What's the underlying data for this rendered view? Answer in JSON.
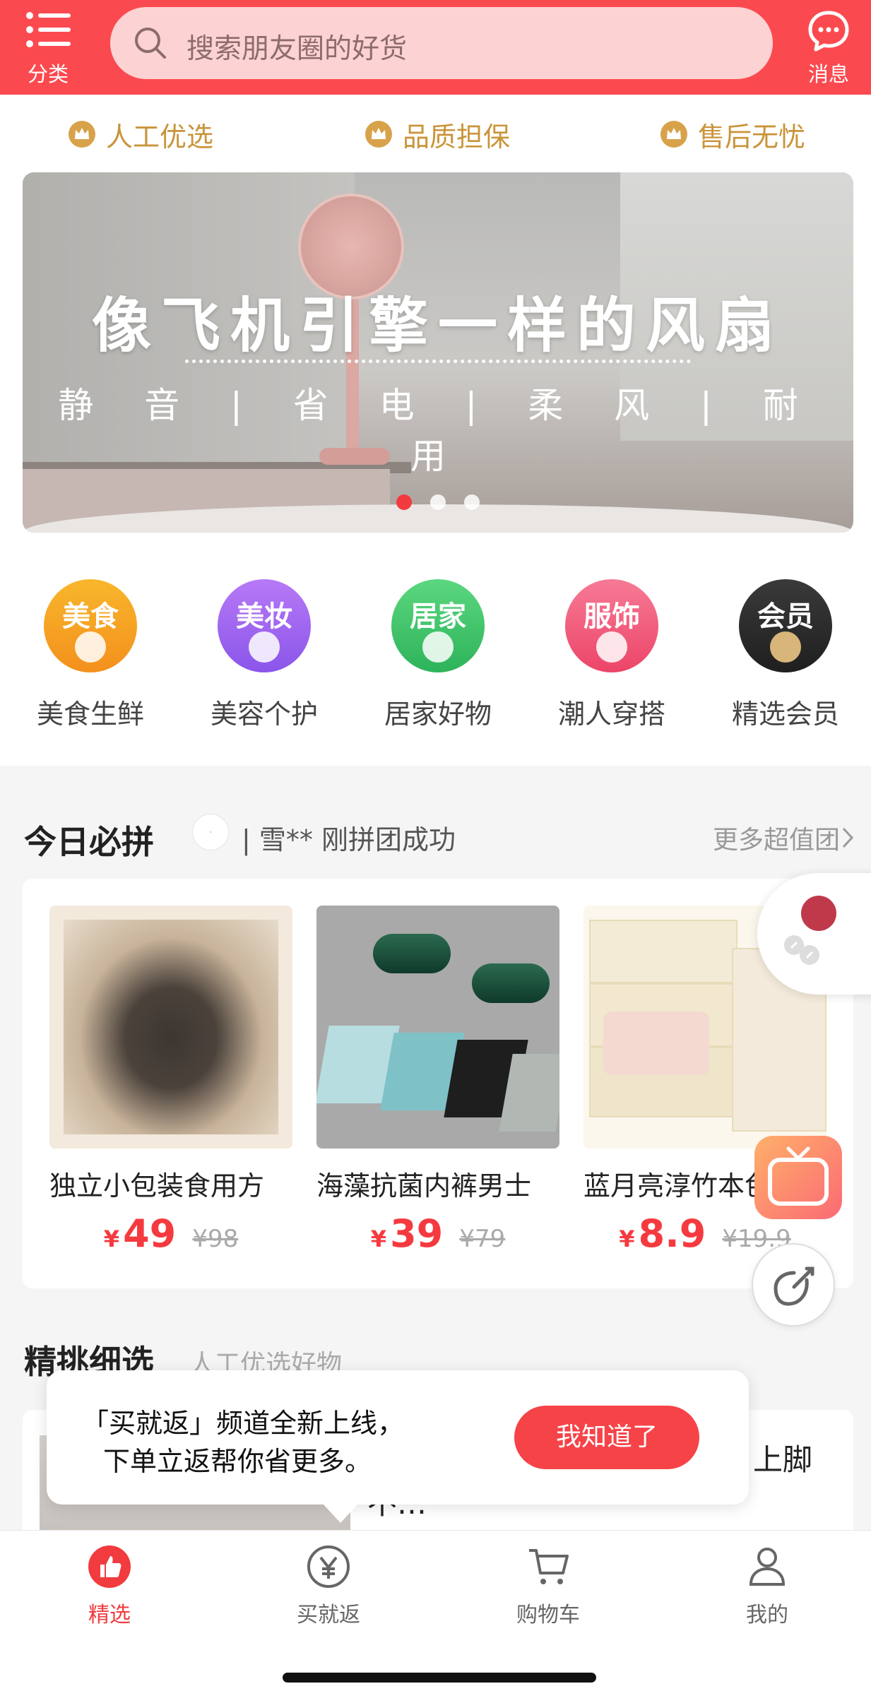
{
  "header": {
    "category_label": "分类",
    "search_placeholder": "搜索朋友圈的好货",
    "message_label": "消息"
  },
  "assurances": [
    "人工优选",
    "品质担保",
    "售后无忧"
  ],
  "banner": {
    "title": "像飞机引擎一样的风扇",
    "subtitle": "静 音 | 省 电 | 柔 风 | 耐 用",
    "dots": 3,
    "active_dot": 0
  },
  "categories": [
    {
      "badge": "美食",
      "label": "美食生鲜",
      "color": "#f6a51e"
    },
    {
      "badge": "美妆",
      "label": "美容个护",
      "color": "#9a63f0"
    },
    {
      "badge": "居家",
      "label": "居家好物",
      "color": "#3fc86a"
    },
    {
      "badge": "服饰",
      "label": "潮人穿搭",
      "color": "#f2587a"
    },
    {
      "badge": "会员",
      "label": "精选会员",
      "color": "#2e2e2e"
    }
  ],
  "today": {
    "title": "今日必拼",
    "ticker": "| 雪** 刚拼团成功",
    "more": "更多超值团",
    "products": [
      {
        "name": "独立小包装食用方",
        "currency": "¥",
        "price": "49",
        "old_price": "¥98"
      },
      {
        "name": "海藻抗菌内裤男士",
        "currency": "¥",
        "price": "39",
        "old_price": "¥79"
      },
      {
        "name": "蓝月亮淳竹本色",
        "currency": "¥",
        "price": "8.9",
        "old_price": "¥19.9"
      }
    ]
  },
  "curated": {
    "title": "精挑细选",
    "subtitle": "人工优选好物",
    "item_text": "仙女编织鞋来了，自拍圈火，上脚不…"
  },
  "tooltip": {
    "line1": "「买就返」频道全新上线，",
    "line2": "下单立返帮你省更多。",
    "button": "我知道了"
  },
  "bottom_nav": [
    {
      "label": "精选",
      "icon": "thumbs-up-icon",
      "active": true
    },
    {
      "label": "买就返",
      "icon": "yuan-icon",
      "active": false
    },
    {
      "label": "购物车",
      "icon": "cart-icon",
      "active": false
    },
    {
      "label": "我的",
      "icon": "user-icon",
      "active": false
    }
  ]
}
